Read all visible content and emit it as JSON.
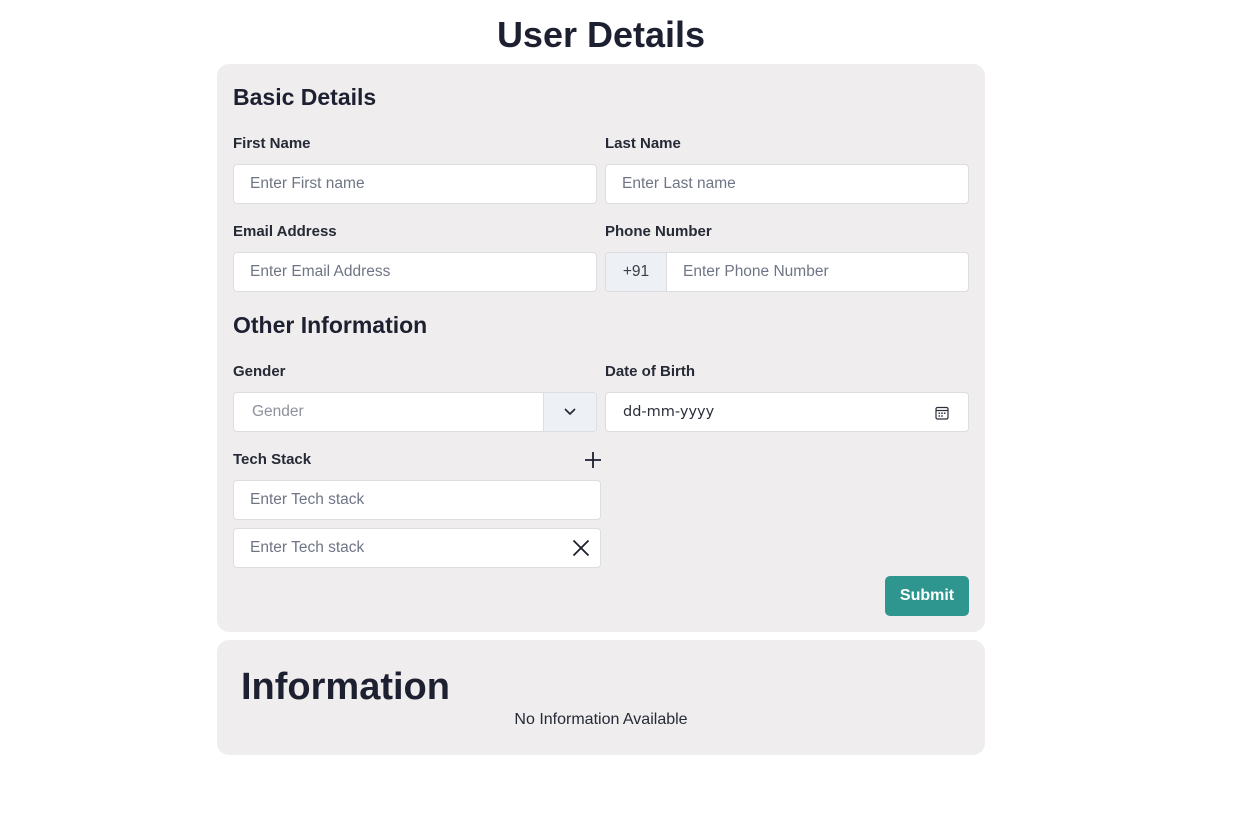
{
  "page": {
    "title": "User Details"
  },
  "form": {
    "basic_section_title": "Basic Details",
    "first_name": {
      "label": "First Name",
      "placeholder": "Enter First name",
      "value": ""
    },
    "last_name": {
      "label": "Last Name",
      "placeholder": "Enter Last name",
      "value": ""
    },
    "email": {
      "label": "Email Address",
      "placeholder": "Enter Email Address",
      "value": ""
    },
    "phone": {
      "label": "Phone Number",
      "prefix": "+91",
      "placeholder": "Enter Phone Number",
      "value": ""
    },
    "other_section_title": "Other Information",
    "gender": {
      "label": "Gender",
      "placeholder": "Gender",
      "icon": "chevron-down-icon"
    },
    "dob": {
      "label": "Date of Birth",
      "placeholder": "dd-mm-yyyy",
      "icon": "calendar-icon"
    },
    "tech_stack": {
      "label": "Tech Stack",
      "add_icon": "plus-icon",
      "remove_icon": "close-icon",
      "items": [
        {
          "placeholder": "Enter Tech stack",
          "value": ""
        },
        {
          "placeholder": "Enter Tech stack",
          "value": ""
        }
      ]
    },
    "submit_label": "Submit",
    "accent_color": "#2f958f"
  },
  "information": {
    "title": "Information",
    "empty_text": "No Information Available"
  }
}
